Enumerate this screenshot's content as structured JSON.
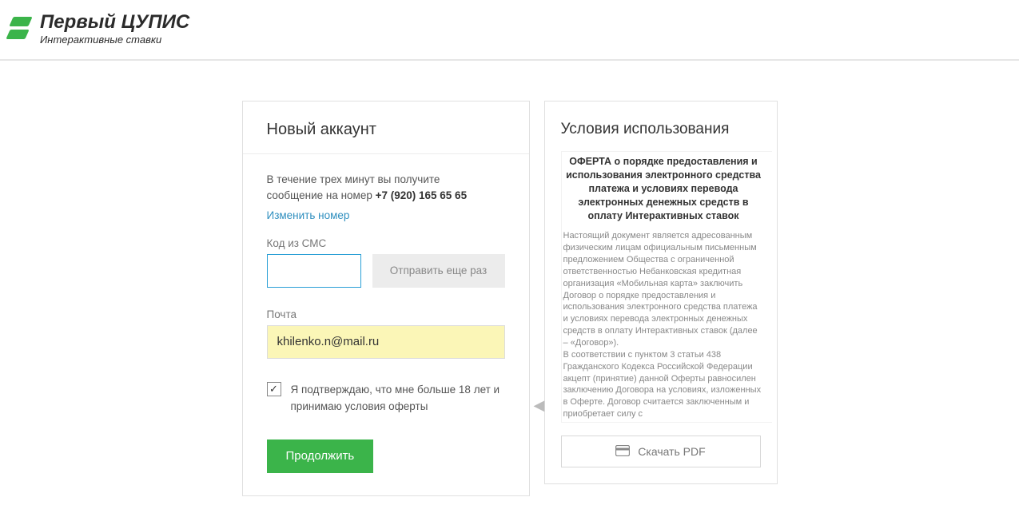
{
  "header": {
    "brand_title": "Первый ЦУПИС",
    "brand_subtitle": "Интерактивные ставки"
  },
  "account": {
    "title": "Новый аккаунт",
    "msg_line1": "В течение трех минут вы получите",
    "msg_line2_prefix": "сообщение на номер ",
    "phone": "+7 (920) 165 65 65",
    "change_link": "Изменить номер",
    "sms_label": "Код из СМС",
    "sms_value": "",
    "resend_label": "Отправить еще раз",
    "email_label": "Почта",
    "email_value": "khilenko.n@mail.ru",
    "confirm_checked": true,
    "confirm_text": "Я подтверждаю, что мне больше 18 лет и принимаю условия оферты",
    "continue_label": "Продолжить"
  },
  "terms": {
    "title": "Условия использования",
    "offer_heading": "ОФЕРТА о порядке предоставления и использования электронного средства платежа и условиях перевода электронных денежных средств в оплату Интерактивных ставок",
    "body_p1": "Настоящий документ является адресованным физическим лицам официальным письменным предложением Общества с ограниченной ответственностью Небанковская кредитная организация «Мобильная карта» заключить Договор о порядке предоставления и использования электронного средства платежа и условиях перевода электронных денежных средств в оплату Интерактивных ставок (далее – «Договор»).",
    "body_p2": "В соответствии с пунктом 3 статьи 438 Гражданского Кодекса Российской Федерации акцепт (принятие) данной Оферты равносилен заключению Договора на условиях, изложенных в Оферте. Договор считается заключенным и приобретает силу с",
    "download_label": "Скачать PDF"
  },
  "icons": {
    "check": "✓",
    "arrow_left": "◀",
    "card": "card"
  }
}
